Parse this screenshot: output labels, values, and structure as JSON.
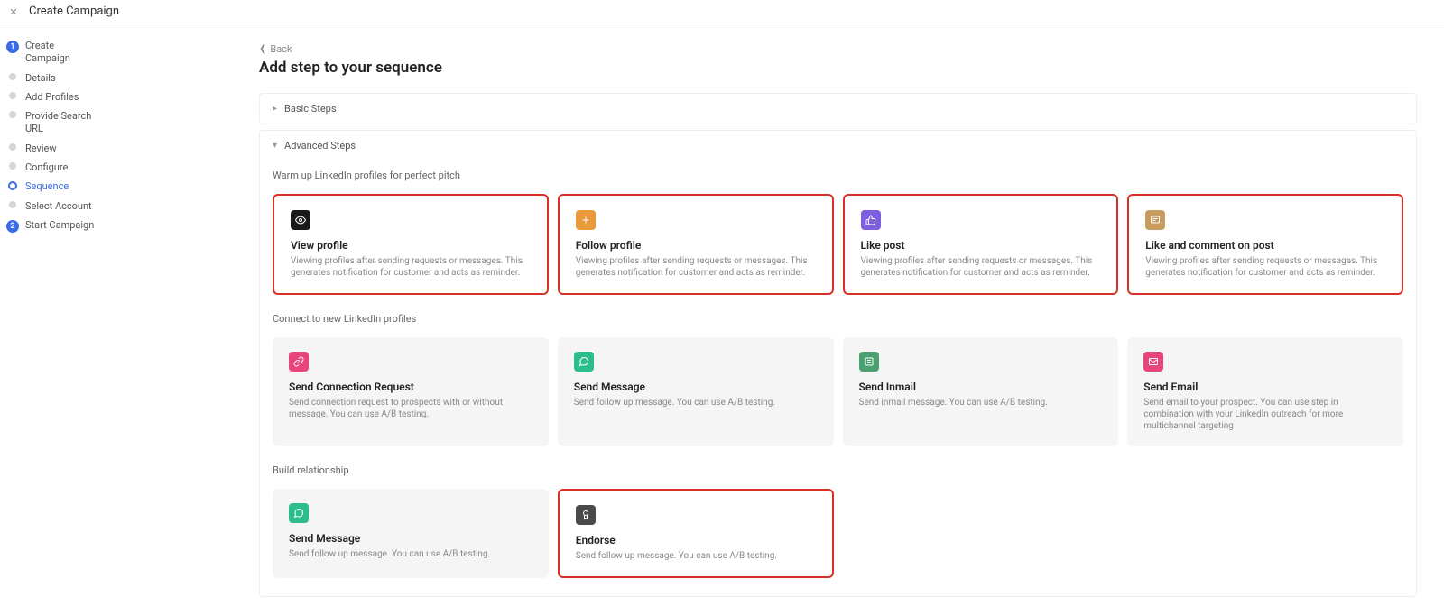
{
  "topbar": {
    "title": "Create Campaign"
  },
  "sidebar": {
    "items": [
      {
        "label": "Create Campaign"
      },
      {
        "label": "Details"
      },
      {
        "label": "Add Profiles"
      },
      {
        "label": "Provide Search URL"
      },
      {
        "label": "Review"
      },
      {
        "label": "Configure"
      },
      {
        "label": "Sequence"
      },
      {
        "label": "Select Account"
      },
      {
        "label": "Start Campaign"
      }
    ]
  },
  "main": {
    "back": "Back",
    "title": "Add step to your sequence",
    "basic_steps": "Basic Steps",
    "advanced_steps": "Advanced Steps",
    "section1": {
      "heading": "Warm up LinkedIn profiles for perfect pitch",
      "cards": [
        {
          "title": "View profile",
          "desc": "Viewing profiles after sending requests or messages. This generates notification for customer and acts as reminder."
        },
        {
          "title": "Follow profile",
          "desc": "Viewing profiles after sending requests or messages. This generates notification for customer and acts as reminder."
        },
        {
          "title": "Like post",
          "desc": "Viewing profiles after sending requests or messages. This generates notification for customer and acts as reminder."
        },
        {
          "title": "Like and comment on post",
          "desc": "Viewing profiles after sending requests or messages. This generates notification for customer and acts as reminder."
        }
      ]
    },
    "section2": {
      "heading": "Connect to new LinkedIn profiles",
      "cards": [
        {
          "title": "Send Connection Request",
          "desc": "Send connection request to prospects with or without message. You can use A/B testing."
        },
        {
          "title": "Send Message",
          "desc": "Send follow up message. You can use A/B testing."
        },
        {
          "title": "Send Inmail",
          "desc": "Send inmail message. You can use A/B testing."
        },
        {
          "title": "Send Email",
          "desc": "Send email to your prospect. You can use step in combination with your LinkedIn outreach for more multichannel targeting"
        }
      ]
    },
    "section3": {
      "heading": "Build relationship",
      "cards": [
        {
          "title": "Send Message",
          "desc": "Send follow up message. You can use A/B testing."
        },
        {
          "title": "Endorse",
          "desc": "Send follow up message. You can use A/B testing."
        }
      ]
    }
  }
}
